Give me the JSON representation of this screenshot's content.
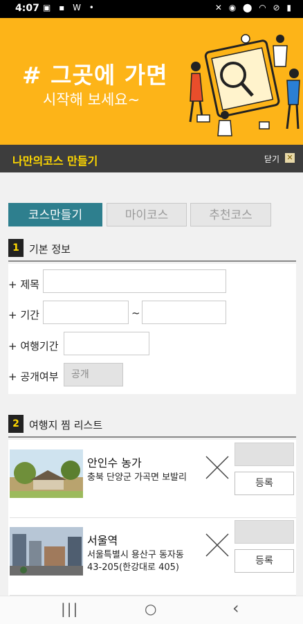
{
  "status_bar": {
    "time": "4:07",
    "left_icons": [
      "image-icon",
      "app-icon",
      "w-icon",
      "dot-icon"
    ],
    "right_icons": [
      "mute-icon",
      "alarm-icon",
      "location-icon",
      "wifi-icon",
      "dnd-icon",
      "battery-icon"
    ]
  },
  "banner": {
    "title": "# 그곳에 가면",
    "subtitle": "시작해 보세요~",
    "background": "#FDB418"
  },
  "header_bar": {
    "title": "나만의코스 만들기",
    "close_label": "닫기",
    "title_color": "#FFD800"
  },
  "tabs": [
    {
      "label": "코스만들기",
      "active": true
    },
    {
      "label": "마이코스",
      "active": false
    },
    {
      "label": "추천코스",
      "active": false
    }
  ],
  "section1": {
    "number": "1",
    "title": "기본 정보",
    "fields": {
      "title_label": "+ 제목",
      "title_value": "",
      "period_label": "+ 기간",
      "period_start": "",
      "period_separator": "~",
      "period_end": "",
      "duration_label": "+ 여행기간",
      "duration_value": "",
      "public_label": "+ 공개여부",
      "public_value": "공개"
    }
  },
  "section2": {
    "number": "2",
    "title": "여행지 찜 리스트",
    "items": [
      {
        "name": "안인수 농가",
        "address": "충북 단양군 가곡면 보발리",
        "register_label": "등록"
      },
      {
        "name": "서울역",
        "address_line1": "서울특별시 용산구 동자동",
        "address_line2": "43-205(한강대로 405)",
        "register_label": "등록"
      }
    ]
  },
  "nav_bar": {
    "recents": "|||",
    "home": "○",
    "back": "‹"
  },
  "colors": {
    "accent": "#2e7f8e",
    "dark_bar": "#3d3d3d"
  }
}
